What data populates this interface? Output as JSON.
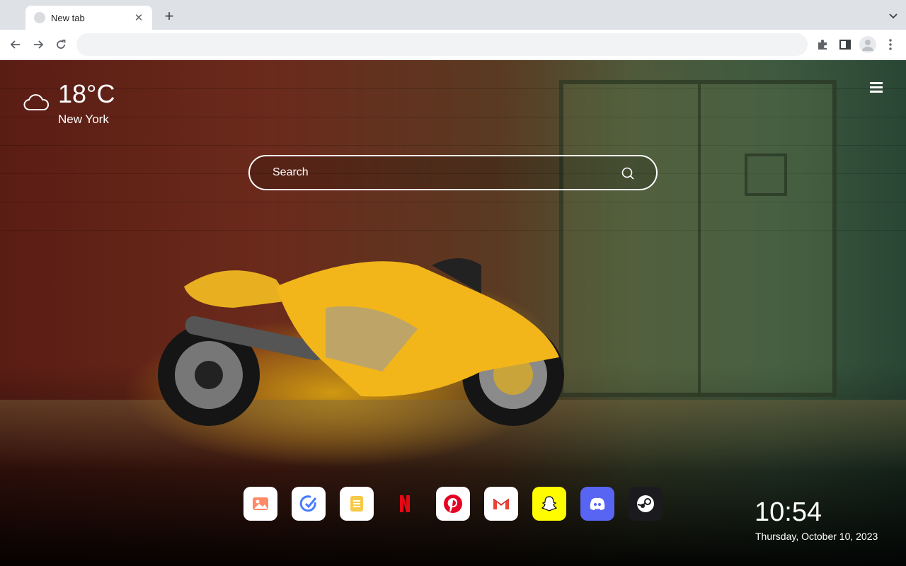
{
  "browser": {
    "tab_title": "New tab",
    "tab_close_glyph": "✕",
    "new_tab_glyph": "+",
    "omnibox_value": ""
  },
  "weather": {
    "temperature": "18°C",
    "city": "New York",
    "icon": "cloud-icon"
  },
  "search": {
    "placeholder": "Search"
  },
  "dock": {
    "apps": [
      {
        "name": "photos",
        "icon": "image-icon",
        "bg": "#ffffff"
      },
      {
        "name": "tasks",
        "icon": "check-circle-icon",
        "bg": "#ffffff"
      },
      {
        "name": "notes",
        "icon": "notes-icon",
        "bg": "#ffffff"
      },
      {
        "name": "netflix",
        "icon": "netflix-icon",
        "bg": "transparent"
      },
      {
        "name": "pinterest",
        "icon": "pinterest-icon",
        "bg": "#ffffff"
      },
      {
        "name": "gmail",
        "icon": "gmail-icon",
        "bg": "#ffffff"
      },
      {
        "name": "snapchat",
        "icon": "snapchat-icon",
        "bg": "#fffc00"
      },
      {
        "name": "discord",
        "icon": "discord-icon",
        "bg": "#5865f2"
      },
      {
        "name": "steam",
        "icon": "steam-icon",
        "bg": "#1b1b1f"
      }
    ]
  },
  "clock": {
    "time": "10:54",
    "date": "Thursday, October 10, 2023"
  }
}
